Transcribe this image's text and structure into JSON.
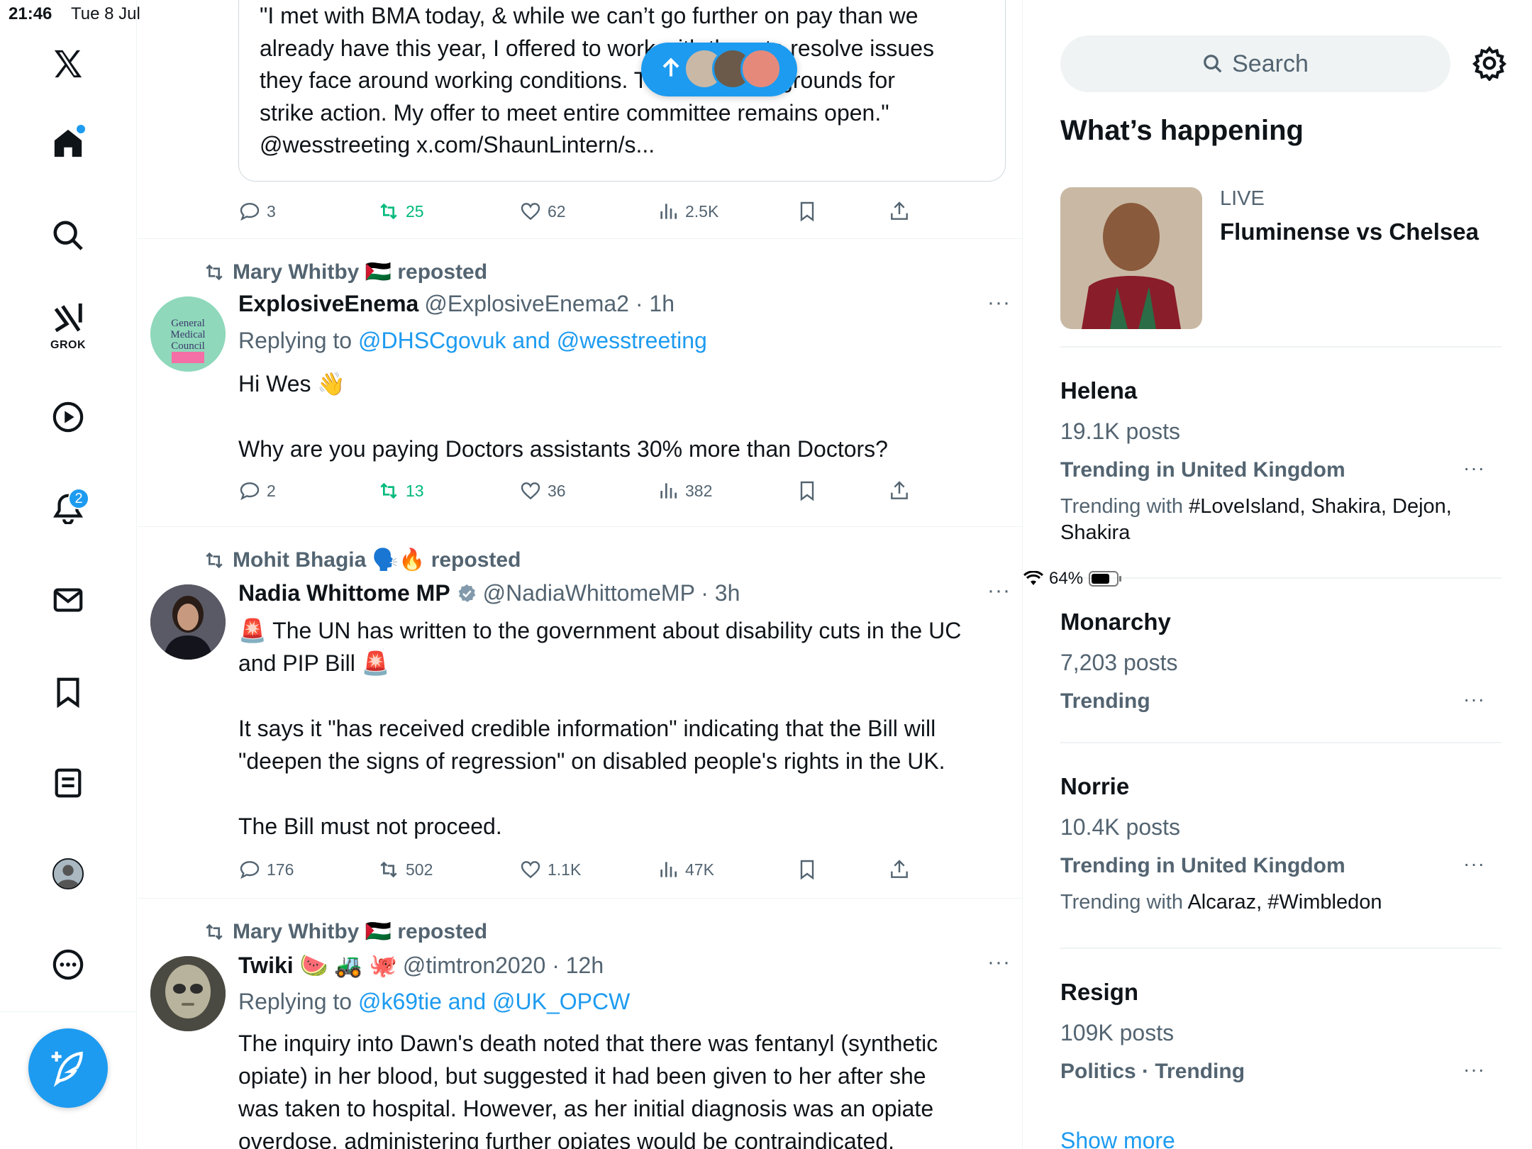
{
  "status_bar": {
    "time": "21:46",
    "date": "Tue 8 Jul",
    "battery": "64%"
  },
  "sidebar": {
    "items": [
      {
        "name": "x-logo-icon"
      },
      {
        "name": "home-icon"
      },
      {
        "name": "search-icon"
      },
      {
        "name": "grok-icon",
        "label": "GROK"
      },
      {
        "name": "video-icon"
      },
      {
        "name": "notifications-icon",
        "badge": "2"
      },
      {
        "name": "messages-icon"
      },
      {
        "name": "bookmarks-icon"
      },
      {
        "name": "lists-icon"
      },
      {
        "name": "profile-icon"
      },
      {
        "name": "more-icon"
      }
    ]
  },
  "feed": {
    "quote": {
      "lines": [
        "\"I met with BMA today, & while we can’t go further on pay than we",
        "already have this year, I offered to work with them to resolve issues",
        "they face around working conditions. These are not grounds for",
        "strike action. My offer to meet entire committee remains open.\"",
        "@wesstreeting x.com/ShaunLintern/s..."
      ],
      "stats": {
        "replies": "3",
        "reposts": "25",
        "likes": "62",
        "views": "2.5K"
      }
    },
    "posts": [
      {
        "reposted_by": "Mary Whitby 🇵🇸 reposted",
        "name": "ExplosiveEnema",
        "handle": "@ExplosiveEnema2 · 1h",
        "replying_prefix": "Replying to ",
        "replying_to": "@DHSCgovuk and @wesstreeting",
        "body": [
          "Hi Wes 👋",
          "",
          "Why are you paying Doctors assistants 30% more than Doctors?"
        ],
        "avatar_text": "General Medical Council",
        "stats": {
          "replies": "2",
          "reposts": "13",
          "likes": "36",
          "views": "382"
        }
      },
      {
        "reposted_by": "Mohit Bhagia 🗣️🔥 reposted",
        "name": "Nadia Whittome MP",
        "handle": "@NadiaWhittomeMP · 3h",
        "body": [
          "🚨 The UN has written to the government about disability cuts in the UC",
          "and PIP Bill 🚨",
          "",
          "It says it \"has received credible information\" indicating that the Bill will",
          "\"deepen the signs of regression\" on disabled people's rights in the UK.",
          "",
          "The Bill must not proceed."
        ],
        "stats": {
          "replies": "176",
          "reposts": "502",
          "likes": "1.1K",
          "views": "47K"
        }
      },
      {
        "reposted_by": "Mary Whitby 🇵🇸 reposted",
        "name": "Twiki 🍉 🚜 🐙",
        "handle": "@timtron2020 · 12h",
        "replying_prefix": "Replying to ",
        "replying_to": "@k69tie and @UK_OPCW",
        "body": [
          "The inquiry into Dawn's death noted that there was fentanyl (synthetic",
          "opiate) in her blood, but suggested it had been given to her after she",
          "was taken to hospital. However, as her initial diagnosis was an opiate",
          "overdose, administering further opiates would be contraindicated."
        ]
      }
    ]
  },
  "right": {
    "search_placeholder": "Search",
    "whats_happening": "What’s happening",
    "live": {
      "tag": "LIVE",
      "title": "Fluminense vs Chelsea"
    },
    "trends": [
      {
        "name": "Helena",
        "posts": "19.1K posts",
        "context": "Trending in United Kingdom",
        "with_prefix": "Trending with ",
        "with": "#LoveIsland, Shakira, Dejon, Shakira"
      },
      {
        "name": "Monarchy",
        "posts": "7,203 posts",
        "context": "Trending"
      },
      {
        "name": "Norrie",
        "posts": "10.4K posts",
        "context": "Trending in United Kingdom",
        "with_prefix": "Trending with ",
        "with": "Alcaraz, #Wimbledon"
      },
      {
        "name": "Resign",
        "posts": "109K posts",
        "context": "Politics · Trending"
      }
    ],
    "show_more": "Show more"
  }
}
